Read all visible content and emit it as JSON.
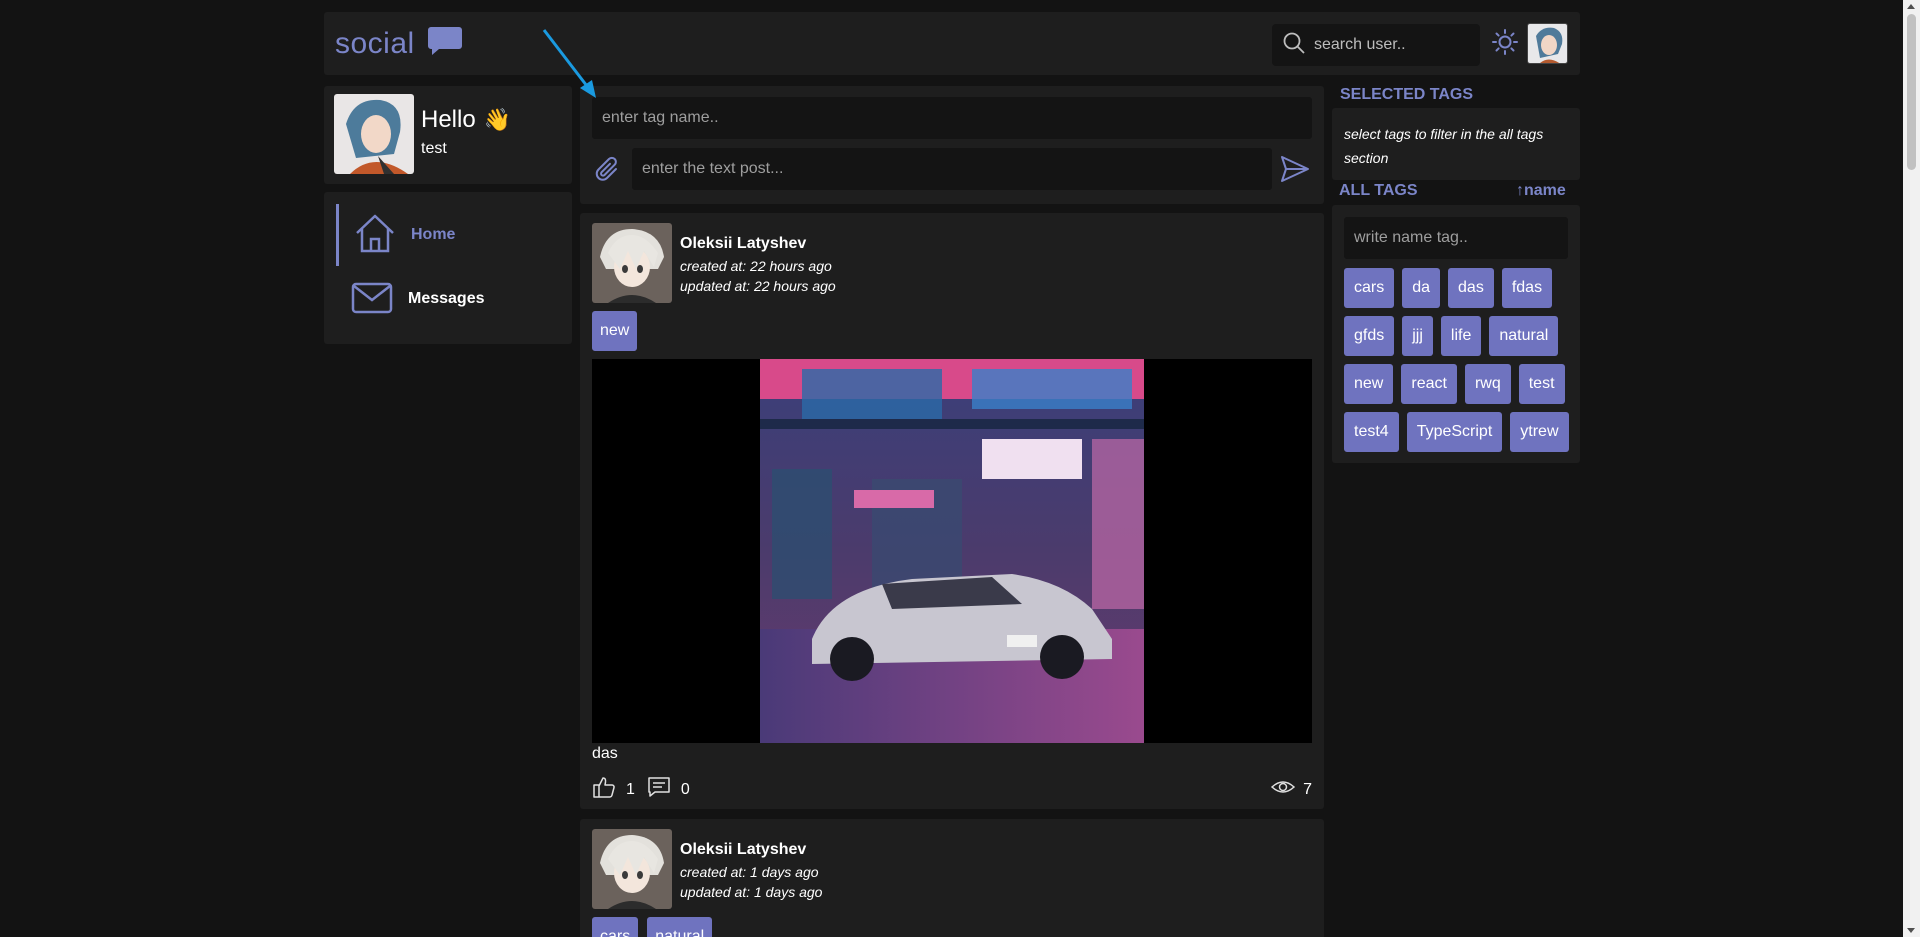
{
  "header": {
    "logo_text": "social",
    "logo_icon": "chat-bubble-icon",
    "search_placeholder": "search user..",
    "theme_icon": "sun-icon",
    "accent_color": "#7b85c8"
  },
  "user": {
    "greeting": "Hello",
    "greeting_emoji": "👋",
    "name": "test"
  },
  "nav": {
    "items": [
      {
        "label": "Home",
        "icon": "home-icon",
        "active": true
      },
      {
        "label": "Messages",
        "icon": "envelope-icon",
        "active": false
      }
    ]
  },
  "composer": {
    "tag_placeholder": "enter tag name..",
    "post_placeholder": "enter the text post...",
    "attach_icon": "paperclip-icon",
    "send_icon": "send-icon"
  },
  "posts": [
    {
      "author": "Oleksii Latyshev",
      "created": "created at: 22 hours ago",
      "updated": "updated at: 22 hours ago",
      "tags": [
        "new"
      ],
      "text": "das",
      "likes": "1",
      "comments": "0",
      "views": "7"
    },
    {
      "author": "Oleksii Latyshev",
      "created": "created at: 1 days ago",
      "updated": "updated at: 1 days ago",
      "tags": [
        "cars",
        "natural"
      ]
    }
  ],
  "sidebar": {
    "selected_title": "SELECTED TAGS",
    "selected_hint": "select tags to filter in the all tags section",
    "all_title": "ALL TAGS",
    "sort_label": "↑name",
    "tag_placeholder": "write name tag..",
    "tags": [
      "cars",
      "da",
      "das",
      "fdas",
      "gfds",
      "jjj",
      "life",
      "natural",
      "new",
      "react",
      "rwq",
      "test",
      "test4",
      "TypeScript",
      "ytrew"
    ],
    "tag_color": "#6f73bf"
  }
}
